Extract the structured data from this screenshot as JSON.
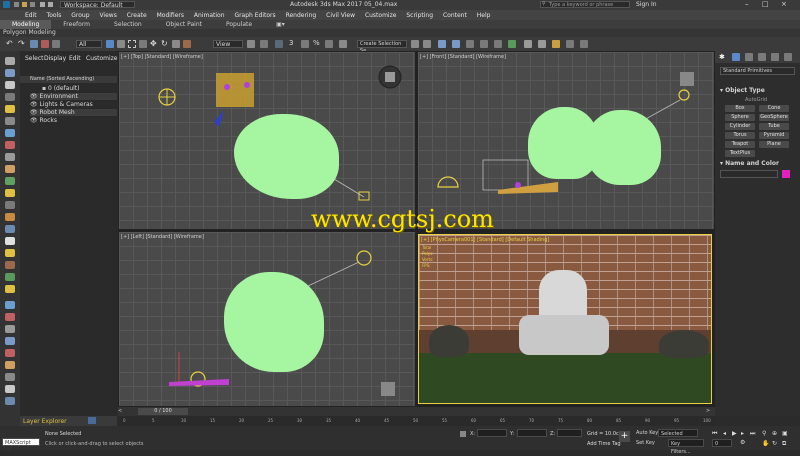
{
  "titlebar": {
    "workspace": "Workspace: Default",
    "title": "Autodesk 3ds Max 2017    05_04.max",
    "search_placeholder": "Type a keyword or phrase",
    "user": "Sign In"
  },
  "menu": [
    "Edit",
    "Tools",
    "Group",
    "Views",
    "Create",
    "Modifiers",
    "Animation",
    "Graph Editors",
    "Rendering",
    "Civil View",
    "Customize",
    "Scripting",
    "Content",
    "Help"
  ],
  "ribbon_tabs": [
    "Modeling",
    "Freeform",
    "Selection",
    "Object Paint",
    "Populate"
  ],
  "ribbon_label": "Polygon Modeling",
  "toolbar": {
    "filter": "All",
    "view": "View",
    "selection_set": "Create Selection Se"
  },
  "scene_explorer": {
    "tabs": [
      "Select",
      "Display",
      "Edit",
      "Customize"
    ],
    "header": "Name (Sorted Ascending)",
    "rows": [
      "0 (default)",
      "Environment",
      "Lights & Cameras",
      "Robot Mesh",
      "Rocks"
    ]
  },
  "layer_explorer": "Layer Explorer",
  "viewports": {
    "top": "[+] [Top] [Standard] [Wireframe]",
    "front": "[+] [Front] [Standard] [Wireframe]",
    "left": "[+] [Left] [Standard] [Wireframe]",
    "camera": "[+] [PhysCamera001] [Standard] [Default Shading]"
  },
  "camera_stats": [
    "Total",
    "Polys:",
    "Verts:",
    "FPS:"
  ],
  "command_panel": {
    "dropdown": "Standard Primitives",
    "object_type": "Object Type",
    "autogrid": "AutoGrid",
    "buttons": [
      "Box",
      "Cone",
      "Sphere",
      "GeoSphere",
      "Cylinder",
      "Tube",
      "Torus",
      "Pyramid",
      "Teapot",
      "Plane",
      "TextPlus"
    ],
    "name_and_color": "Name and Color"
  },
  "timeline": {
    "frame": "0 / 100",
    "ticks": [
      "0",
      "5",
      "10",
      "15",
      "20",
      "25",
      "30",
      "35",
      "40",
      "45",
      "50",
      "55",
      "60",
      "65",
      "70",
      "75",
      "80",
      "85",
      "90",
      "95",
      "100"
    ]
  },
  "status": {
    "listener": "MAXScript Mi",
    "selected": "None Selected",
    "hint": "Click or click-and-drag to select objects",
    "x_label": "X:",
    "y_label": "Y:",
    "z_label": "Z:",
    "grid": "Grid = 10.0cm",
    "add_time_tag": "Add Time Tag",
    "auto_key": "Auto Key",
    "set_key": "Set Key",
    "selected_dropdown": "Selected",
    "key_filters": "Key Filters...",
    "frame_field": "0"
  },
  "watermark": "www.cgtsj.com",
  "colors": {
    "tree": "#a6f5a0",
    "watermark": "#ffe600",
    "accent": "#e0b040"
  }
}
